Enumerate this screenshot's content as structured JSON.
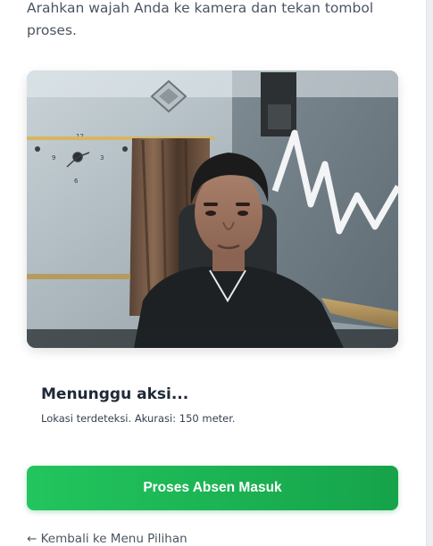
{
  "instruction": "Arahkan wajah Anda ke kamera dan tekan tombol proses.",
  "camera": {
    "icon": "camera-feed"
  },
  "status": {
    "title": "Menunggu aksi...",
    "detail": "Lokasi terdeteksi. Akurasi: 150 meter."
  },
  "actions": {
    "process_label": "Proses Absen Masuk",
    "back_label": "← Kembali ke Menu Pilihan"
  },
  "colors": {
    "accent": "#22c55e",
    "accent_dark": "#16a34a",
    "text_primary": "#1f2937",
    "text_muted": "#4b5563"
  }
}
